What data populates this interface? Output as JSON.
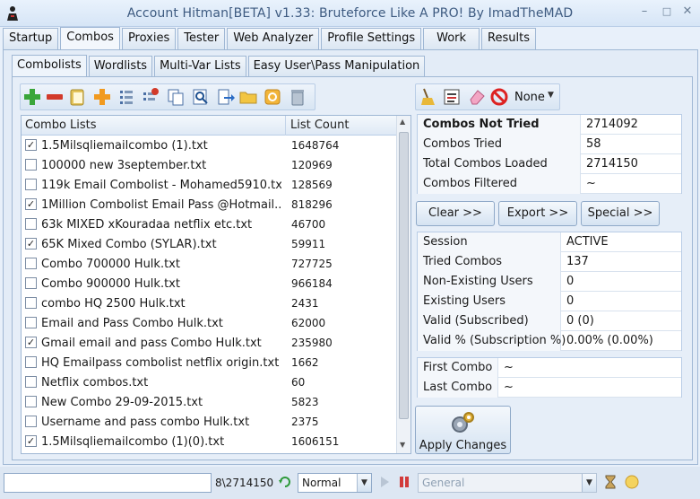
{
  "window": {
    "title": "Account Hitman[BETA] v1.33: Bruteforce Like A PRO!  By ImadTheMAD",
    "controls": [
      "minimize-icon",
      "maximize-icon",
      "close-icon"
    ]
  },
  "main_tabs": [
    "Startup",
    "Combos",
    "Proxies",
    "Tester",
    "Web Analyzer",
    "Profile Settings",
    "Work",
    "Results"
  ],
  "main_tab_active": "Combos",
  "sub_tabs": [
    "Combolists",
    "Wordlists",
    "Multi-Var Lists",
    "Easy User\\Pass Manipulation"
  ],
  "sub_tab_active": "Combolists",
  "toolbar_icons": [
    "add-icon",
    "remove-icon",
    "paste-icon",
    "add-multiple-icon",
    "list-icon",
    "remove-list-icon",
    "copy-icon",
    "search-icon",
    "import-icon",
    "folder-icon",
    "refresh-icon",
    "trash-icon"
  ],
  "filter_toolbar": {
    "icons": [
      "broom-icon",
      "list-filter-icon",
      "eraser-icon",
      "block-icon"
    ],
    "filter_value": "None"
  },
  "combo_list": {
    "col_name": "Combo Lists",
    "col_count": "List Count",
    "rows": [
      {
        "name": "1.5Milsqliemailcombo (1).txt",
        "count": "1648764",
        "checked": true
      },
      {
        "name": "100000 new 3september.txt",
        "count": "120969",
        "checked": false
      },
      {
        "name": "119k Email Combolist - Mohamed5910.txt",
        "count": "128569",
        "checked": false
      },
      {
        "name": "1Million Combolist Email Pass @Hotmail....",
        "count": "818296",
        "checked": true
      },
      {
        "name": "63k MIXED xKouradaa netflix etc.txt",
        "count": "46700",
        "checked": false
      },
      {
        "name": "65K Mixed Combo (SYLAR).txt",
        "count": "59911",
        "checked": true
      },
      {
        "name": "Combo 700000 Hulk.txt",
        "count": "727725",
        "checked": false
      },
      {
        "name": "Combo 900000 Hulk.txt",
        "count": "966184",
        "checked": false
      },
      {
        "name": "combo HQ 2500 Hulk.txt",
        "count": "2431",
        "checked": false
      },
      {
        "name": "Email and Pass Combo Hulk.txt",
        "count": "62000",
        "checked": false
      },
      {
        "name": "Gmail email and pass Combo Hulk.txt",
        "count": "235980",
        "checked": true
      },
      {
        "name": "HQ Emailpass combolist netflix origin.txt",
        "count": "1662",
        "checked": false
      },
      {
        "name": "Netflix combos.txt",
        "count": "60",
        "checked": false
      },
      {
        "name": "New Combo 29-09-2015.txt",
        "count": "5823",
        "checked": false
      },
      {
        "name": "Username and pass combo Hulk.txt",
        "count": "2375",
        "checked": false
      },
      {
        "name": "1.5Milsqliemailcombo (1)(0).txt",
        "count": "1606151",
        "checked": true
      }
    ]
  },
  "combo_stats": [
    {
      "label": "Combos Not Tried",
      "value": "2714092",
      "bold": true
    },
    {
      "label": "Combos Tried",
      "value": "58"
    },
    {
      "label": "Total Combos Loaded",
      "value": "2714150"
    },
    {
      "label": "Combos Filtered",
      "value": "~"
    }
  ],
  "actions": {
    "clear": "Clear >>",
    "export": "Export >>",
    "special": "Special >>"
  },
  "session": [
    {
      "label": "Session",
      "value": "ACTIVE"
    },
    {
      "label": "Tried Combos",
      "value": "137"
    },
    {
      "label": "Non-Existing Users",
      "value": "0"
    },
    {
      "label": "Existing Users",
      "value": "0"
    },
    {
      "label": "Valid (Subscribed)",
      "value": "0 (0)"
    },
    {
      "label": "Valid % (Subscription %)",
      "value": "0.00% (0.00%)"
    }
  ],
  "combo_range": [
    {
      "label": "First Combo",
      "value": "~"
    },
    {
      "label": "Last Combo",
      "value": "~"
    }
  ],
  "apply_label": "Apply Changes",
  "status": {
    "input_value": "",
    "progress_text": "8\\2714150",
    "mode": "Normal",
    "category_placeholder": "General"
  }
}
